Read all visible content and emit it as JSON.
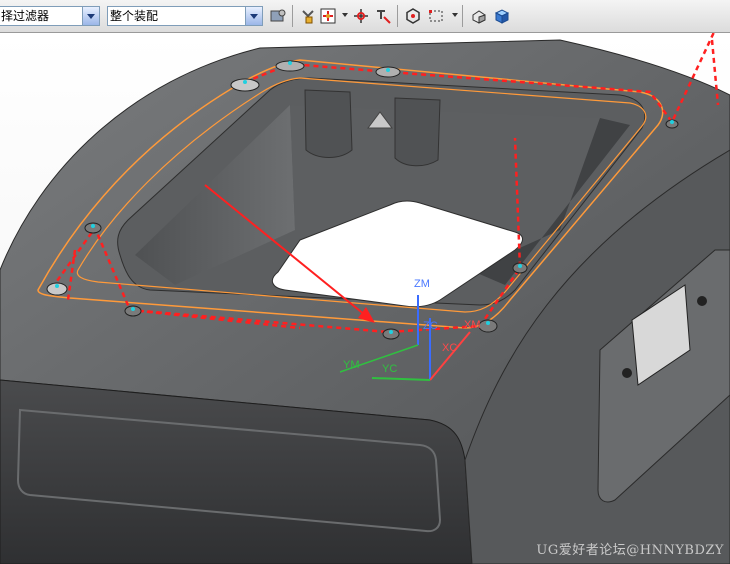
{
  "toolbar": {
    "filter_combo": {
      "value": "择过滤器"
    },
    "scope_combo": {
      "value": "整个装配"
    },
    "icons": [
      "selection-settings-icon",
      "snap-point-icon",
      "filter-point-icon",
      "dropdown-icon",
      "move-icon",
      "mark-icon",
      "view-orient-icon",
      "box-select-icon",
      "dropdown-icon",
      "shaded-icon",
      "solid-cube-icon"
    ]
  },
  "csys": {
    "zm": "ZM",
    "zc": "ZC",
    "xc": "XC",
    "ym": "YM",
    "yc": "YC",
    "xm": "XM"
  },
  "watermark": "UG爱好者论坛@HNNYBDZY",
  "colors": {
    "body": "#5a5c5e",
    "toolpath": "#ff2020",
    "boundary": "#ff9a3a",
    "axis_z": "#3a6cff",
    "axis_x": "#ff4040",
    "axis_y": "#30c040"
  }
}
